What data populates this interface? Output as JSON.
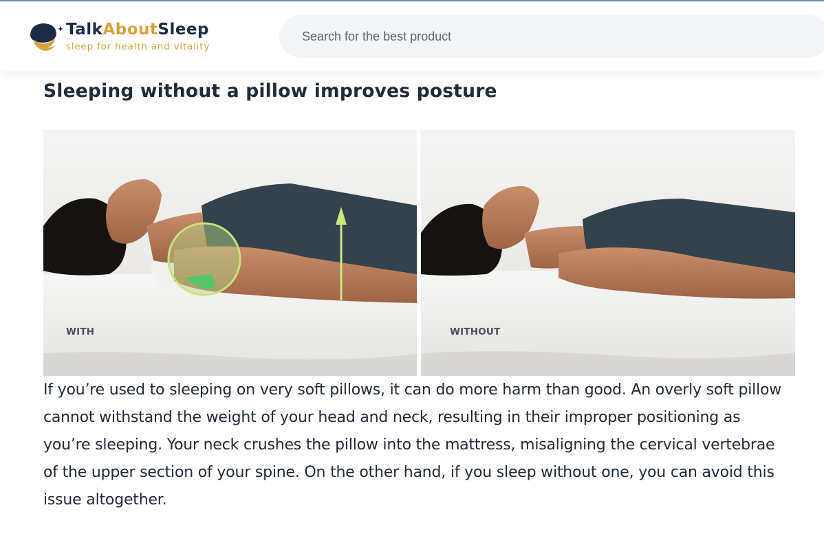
{
  "site": {
    "brand_prefix": "Talk",
    "brand_accent": "About",
    "brand_suffix": "Sleep",
    "tagline": "sleep for health and vitality",
    "colors": {
      "brand_navy": "#1b2b45",
      "brand_gold": "#d6a23c"
    }
  },
  "search": {
    "placeholder": "Search for the best product"
  },
  "article": {
    "heading": "Sleeping without a pillow improves posture",
    "figure": {
      "left_caption": "WITH",
      "right_caption": "WITHOUT"
    },
    "paragraph": "If you’re used to sleeping on very soft pillows, it can do more harm than good. An overly soft pillow cannot withstand the weight of your head and neck, resulting in their improper positioning as you’re sleeping. Your neck crushes the pillow into the mattress, misaligning the cervical vertebrae of the upper section of your spine. On the other hand, if you sleep without one, you can avoid this issue altogether."
  }
}
